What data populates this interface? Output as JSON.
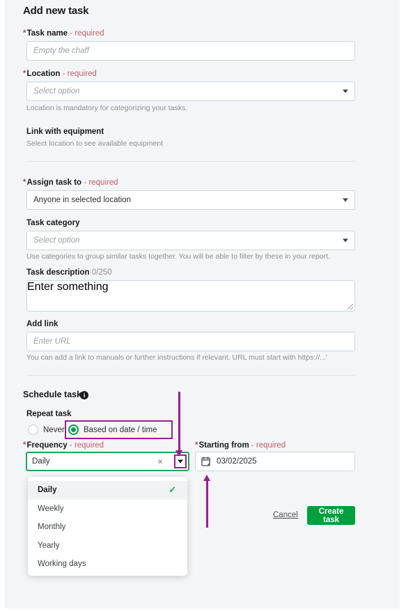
{
  "page": {
    "title": "Add new task"
  },
  "required_suffix": "- required",
  "fields": {
    "task_name": {
      "label": "Task name",
      "required": "- required",
      "placeholder": "Empty the chaff",
      "value": ""
    },
    "location": {
      "label": "Location",
      "required": "- required",
      "placeholder": "Select option",
      "help": "Location is mandatory for categorizing your tasks."
    },
    "link_equipment": {
      "label": "Link with equipment",
      "help": "Select location to see available equipment"
    },
    "assign_task_to": {
      "label": "Assign task to",
      "required": "- required",
      "value": "Anyone in selected location"
    },
    "task_category": {
      "label": "Task category",
      "placeholder": "Select option",
      "help": "Use categories to group similar tasks together. You will be able to filter by these in your report."
    },
    "task_description": {
      "label": "Task description",
      "counter": "0/250",
      "placeholder": "Enter something",
      "value": ""
    },
    "add_link": {
      "label": "Add link",
      "placeholder": "Enter URL",
      "value": "",
      "help": "You can add a link to manuals or further instructions if relevant. URL must start with https://...'"
    }
  },
  "schedule": {
    "heading": "Schedule task",
    "info_icon": "info-icon",
    "info_glyph": "i",
    "repeat_label": "Repeat task",
    "options": [
      {
        "label": "Never",
        "selected": false
      },
      {
        "label": "Based on date / time",
        "selected": true
      }
    ],
    "frequency": {
      "label": "Frequency",
      "required": "- required",
      "value": "Daily",
      "clear_glyph": "×",
      "caret_icon": "chevron-down-icon",
      "options": [
        {
          "label": "Daily",
          "selected": true
        },
        {
          "label": "Weekly",
          "selected": false
        },
        {
          "label": "Monthly",
          "selected": false
        },
        {
          "label": "Yearly",
          "selected": false
        },
        {
          "label": "Working days",
          "selected": false
        }
      ],
      "check_glyph": "✓"
    },
    "starting_from": {
      "label": "Starting from",
      "required": "- required",
      "value": "03/02/2025",
      "icon": "calendar-icon"
    }
  },
  "actions": {
    "cancel": "Cancel",
    "create": "Create task"
  },
  "colors": {
    "annotation_purple": "#9c1d8f",
    "accent_green": "#00a03e",
    "radio_green": "#00a14b",
    "focus_green": "#19a85a",
    "required_red": "#c06070",
    "background": "#f4f5f7"
  }
}
